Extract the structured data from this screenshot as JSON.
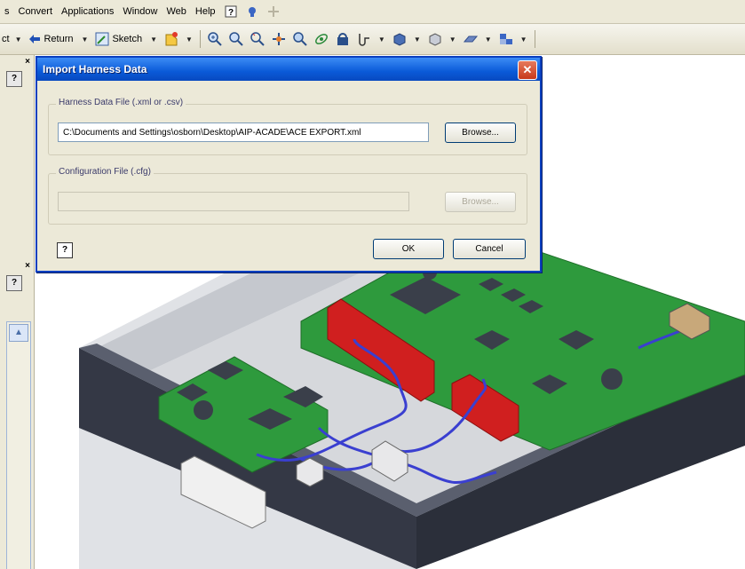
{
  "menu": {
    "items": [
      "s",
      "Convert",
      "Applications",
      "Window",
      "Web",
      "Help"
    ]
  },
  "toolbar": {
    "left_fragment": "ct",
    "return_label": "Return",
    "sketch_label": "Sketch"
  },
  "left_panel": {
    "help_glyph": "?",
    "close_glyph": "×"
  },
  "dialog": {
    "title": "Import Harness Data",
    "close_glyph": "✕",
    "harness_group_label": "Harness Data File (.xml or .csv)",
    "harness_file_value": "C:\\Documents and Settings\\osborn\\Desktop\\AIP-ACADE\\ACE EXPORT.xml",
    "harness_browse_label": "Browse...",
    "config_group_label": "Configuration File (.cfg)",
    "config_file_value": "",
    "config_browse_label": "Browse...",
    "help_glyph": "?",
    "ok_label": "OK",
    "cancel_label": "Cancel"
  },
  "colors": {
    "titlebar": "#0a5ad8",
    "enclosure": "#343845",
    "pcb": "#2e9a3d",
    "connector": "#d01f1f",
    "wire": "#3a3fd0"
  }
}
